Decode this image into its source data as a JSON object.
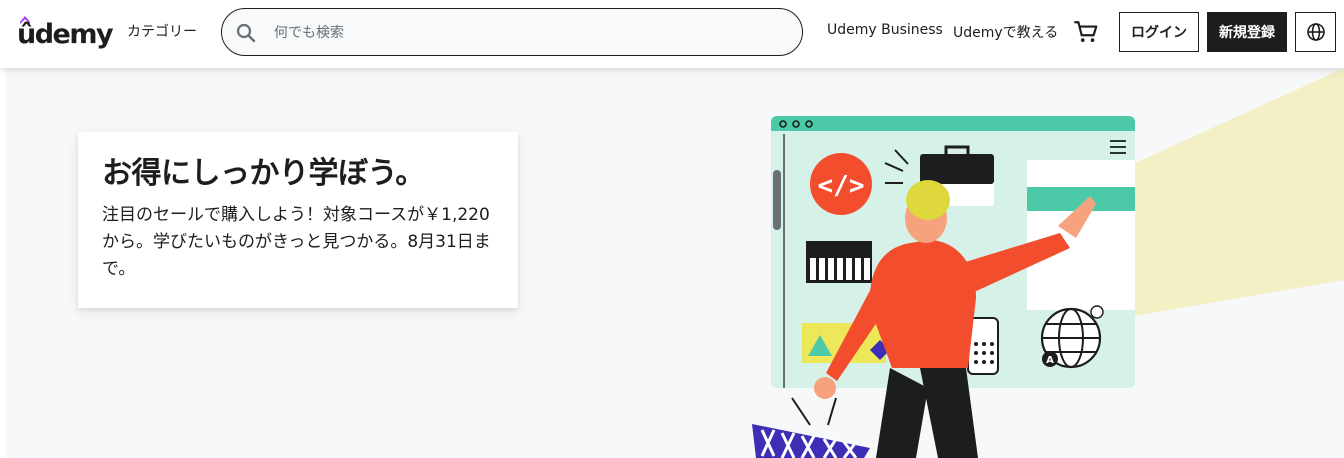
{
  "header": {
    "logo_text": "ûdemy",
    "categories": "カテゴリー",
    "search": {
      "placeholder": "何でも検索"
    },
    "nav": {
      "business": "Udemy Business",
      "teach": "Udemyで教える"
    },
    "login": "ログイン",
    "signup": "新規登録"
  },
  "hero": {
    "title": "お得にしっかり学ぼう。",
    "text": "注目のセールで購入しよう！対象コースが￥1,220から。学びたいものがきっと見つかる。8月31日まで。",
    "illustration_badge": "A"
  },
  "colors": {
    "accent_purple": "#a435f0",
    "dark": "#1c1d1f",
    "teal": "#4cc9a6",
    "red": "#f24e2e",
    "yellow_beam": "#f4f0c6"
  },
  "icons": [
    "search-icon",
    "cart-icon",
    "globe-icon",
    "code-icon",
    "hamburger-icon"
  ]
}
